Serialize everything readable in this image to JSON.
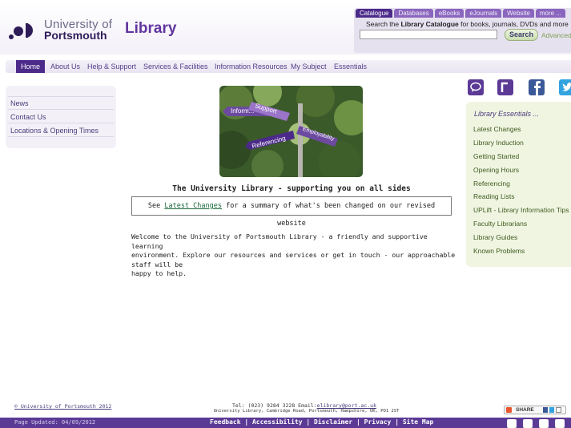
{
  "header": {
    "logo": {
      "line1": "University of",
      "line2": "Portsmouth"
    },
    "title": "Library"
  },
  "search": {
    "tabs": [
      "Catalogue",
      "Databases",
      "eBooks",
      "eJournals",
      "Website",
      "more ..."
    ],
    "label_prefix": "Search the ",
    "label_bold": "Library Catalogue",
    "label_suffix": " for books, journals, DVDs and more",
    "input_value": "",
    "button": "Search",
    "advanced": "Advanced"
  },
  "nav": {
    "items": [
      "Home",
      "About Us",
      "Help & Support",
      "Services & Facilities",
      "Information Resources",
      "My Subject",
      "Essentials"
    ]
  },
  "left_menu": {
    "items": [
      "News",
      "Contact Us",
      "Locations & Opening Times"
    ]
  },
  "hero": {
    "signs": [
      "Inform...",
      "Support",
      "Employability",
      "Referencing"
    ]
  },
  "main": {
    "caption": "The University Library - supporting you on all sides",
    "notice_prefix": "See ",
    "notice_link": "Latest Changes",
    "notice_suffix": " for a summary of what's been changed on our revised website",
    "welcome_lines": [
      "Welcome to the University of Portsmouth Library - a friendly and supportive learning",
      "environment. Explore our resources and services or get in touch - our approachable staff will be",
      "happy to help."
    ]
  },
  "social": [
    "speech-bubble-icon",
    "rss-r-icon",
    "facebook-icon",
    "twitter-icon"
  ],
  "essentials": {
    "title": "Library Essentials ...",
    "items": [
      "Latest Changes",
      "Library Induction",
      "Getting Started",
      "Opening Hours",
      "Referencing",
      "Reading Lists",
      "UPLift - Library Information Tips",
      "Faculty Librarians",
      "Library Guides",
      "Known Problems"
    ]
  },
  "footer": {
    "copyright": "© University of Portsmouth 2012",
    "tel": "Tel: (023) 9284 3228  Email:",
    "email": "elibrary@port.ac.uk",
    "address": "University Library, Cambridge Road, Portsmouth, Hampshire, UK, PO1 2ST",
    "share": "SHARE",
    "updated": "Page Updated: 04/09/2012",
    "links": "Feedback | Accessibility | Disclaimer | Privacy | Site Map"
  },
  "colors": {
    "brand_purple": "#4c2a8a",
    "nav_text": "#53418b",
    "essentials_bg": "#f0f5e2",
    "essentials_text": "#3f5c1e"
  }
}
